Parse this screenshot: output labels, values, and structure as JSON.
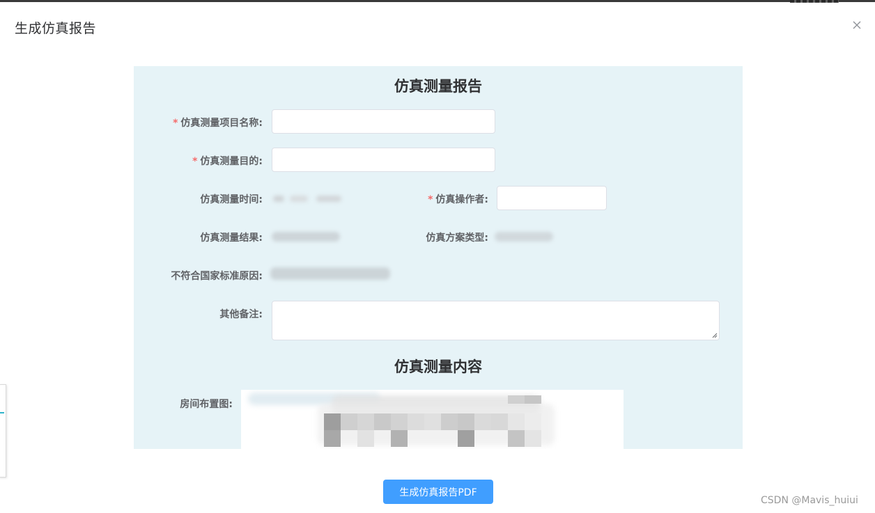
{
  "dialog": {
    "title": "生成仿真报告",
    "close_icon": "close-icon"
  },
  "report": {
    "title": "仿真测量报告",
    "fields": {
      "project_name": {
        "label": "仿真测量项目名称:",
        "required": true,
        "value": ""
      },
      "purpose": {
        "label": "仿真测量目的:",
        "required": true,
        "value": ""
      },
      "time": {
        "label": "仿真测量时间:"
      },
      "operator": {
        "label": "仿真操作者:",
        "required": true,
        "value": ""
      },
      "result": {
        "label": "仿真测量结果:"
      },
      "scheme_type": {
        "label": "仿真方案类型:"
      },
      "nonconform_reason": {
        "label": "不符合国家标准原因:"
      },
      "remarks": {
        "label": "其他备注:",
        "value": ""
      }
    },
    "content_title": "仿真测量内容",
    "room_layout_label": "房间布置图:"
  },
  "actions": {
    "generate_pdf": "生成仿真报告PDF"
  },
  "watermark": "CSDN @Mavis_huiui",
  "colors": {
    "panel_bg": "#e6f3f7",
    "primary": "#409eff",
    "required_star": "#f56c6c",
    "label_text": "#606266"
  }
}
